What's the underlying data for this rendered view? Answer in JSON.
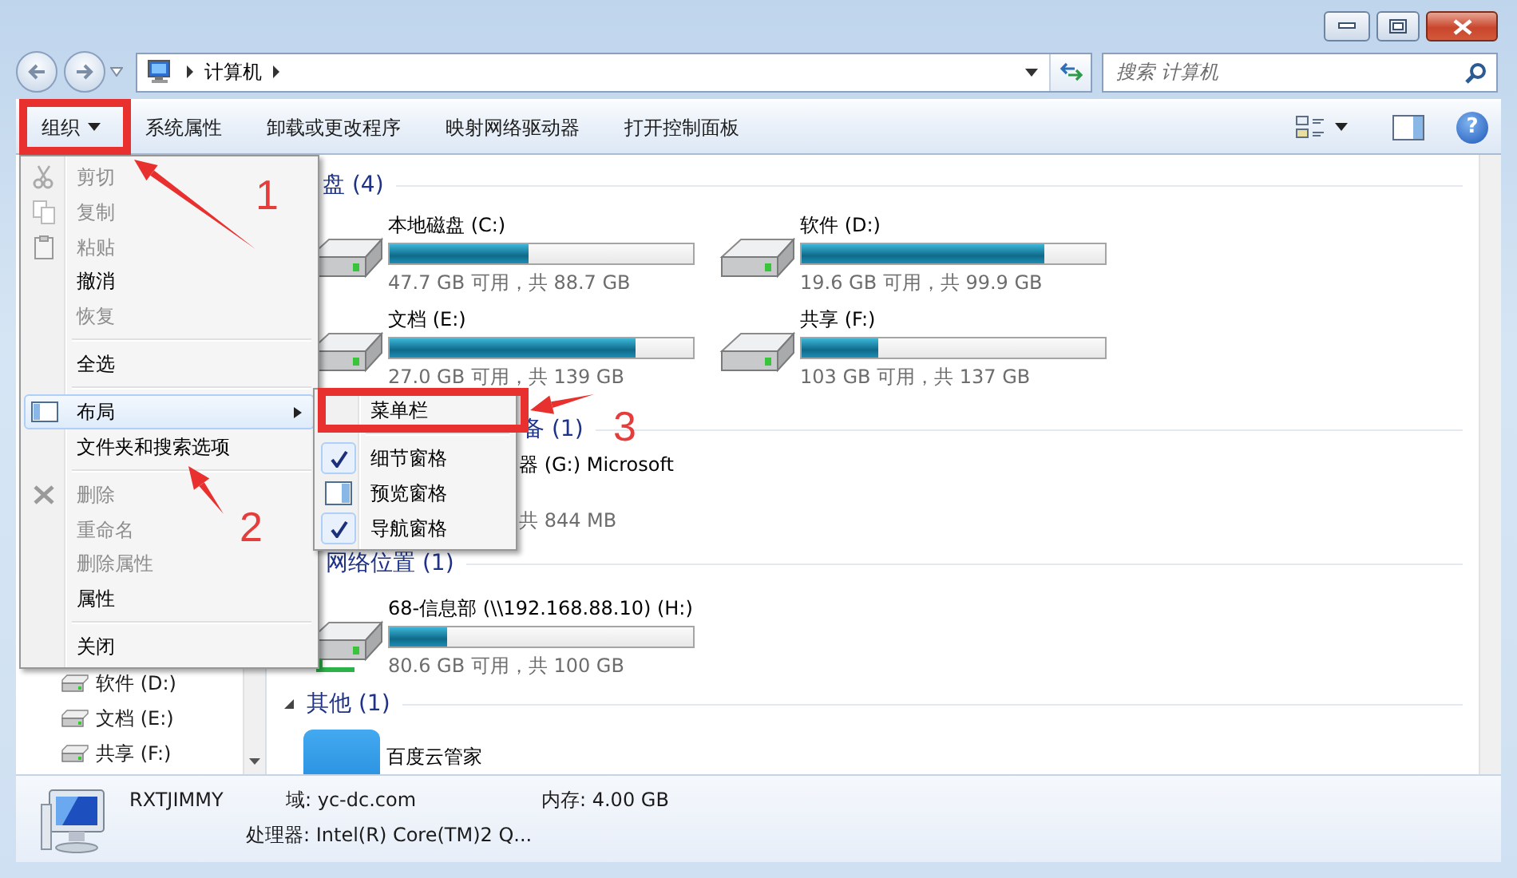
{
  "address_bar": {
    "path": [
      "计算机"
    ],
    "search": {
      "placeholder": "搜索 计算机"
    }
  },
  "toolbar": {
    "buttons": [
      {
        "label": "组织",
        "kind": "menu",
        "annotated": true
      },
      {
        "label": "系统属性",
        "kind": "plain",
        "annotated": false
      },
      {
        "label": "卸载或更改程序",
        "kind": "plain",
        "annotated": false
      },
      {
        "label": "映射网络驱动器",
        "kind": "plain",
        "annotated": false
      },
      {
        "label": "打开控制面板",
        "kind": "plain",
        "annotated": false
      }
    ],
    "help": "?"
  },
  "organize_menu": {
    "items": [
      {
        "kind": "command",
        "label": "剪切",
        "disabled": true,
        "selected": false
      },
      {
        "kind": "command",
        "label": "复制",
        "disabled": true,
        "selected": false
      },
      {
        "kind": "command",
        "label": "粘贴",
        "disabled": true,
        "selected": false
      },
      {
        "kind": "command",
        "label": "撤消",
        "disabled": false,
        "selected": false
      },
      {
        "kind": "command",
        "label": "恢复",
        "disabled": true,
        "selected": false
      },
      {
        "kind": "separator"
      },
      {
        "kind": "command",
        "label": "全选",
        "disabled": false,
        "selected": false
      },
      {
        "kind": "separator"
      },
      {
        "kind": "submenu",
        "label": "布局",
        "disabled": false,
        "selected": true
      },
      {
        "kind": "command",
        "label": "文件夹和搜索选项",
        "disabled": false,
        "selected": false
      },
      {
        "kind": "separator"
      },
      {
        "kind": "command",
        "label": "删除",
        "disabled": true,
        "selected": false
      },
      {
        "kind": "command",
        "label": "重命名",
        "disabled": true,
        "selected": false
      },
      {
        "kind": "command",
        "label": "删除属性",
        "disabled": true,
        "selected": false
      },
      {
        "kind": "command",
        "label": "属性",
        "disabled": false,
        "selected": false
      },
      {
        "kind": "separator"
      },
      {
        "kind": "command",
        "label": "关闭",
        "disabled": false,
        "selected": false
      }
    ]
  },
  "layout_submenu": {
    "items": [
      {
        "kind": "command",
        "label": "菜单栏",
        "checked": false,
        "annotated": true
      },
      {
        "kind": "separator"
      },
      {
        "kind": "command",
        "label": "细节窗格",
        "checked": true,
        "annotated": false
      },
      {
        "kind": "command",
        "label": "预览窗格",
        "checked": false,
        "annotated": false
      },
      {
        "kind": "command",
        "label": "导航窗格",
        "checked": true,
        "annotated": false
      }
    ]
  },
  "navigation_pane": {
    "items": [
      {
        "label": "软件 (D:)"
      },
      {
        "label": "文档 (E:)"
      },
      {
        "label": "共享 (F:)"
      }
    ]
  },
  "content": {
    "sections": [
      {
        "title": "盘 (4)",
        "items": [
          {
            "kind": "disk",
            "name": "本地磁盘 (C:)",
            "level": 0.46,
            "free": "47.7 GB 可用，共 88.7 GB"
          },
          {
            "kind": "disk",
            "name": "软件 (D:)",
            "level": 0.8,
            "free": "19.6 GB 可用，共 99.9 GB"
          },
          {
            "kind": "disk",
            "name": "文档 (E:)",
            "level": 0.81,
            "free": "27.0 GB 可用，共 139 GB"
          },
          {
            "kind": "disk",
            "name": "共享 (F:)",
            "level": 0.25,
            "free": "103 GB 可用，共 137 GB"
          }
        ]
      },
      {
        "title": "备 (1)",
        "items": [
          {
            "kind": "removable",
            "name": "器 (G:) Microsoft",
            "free": "共 844 MB"
          }
        ]
      },
      {
        "title": "网络位置 (1)",
        "items": [
          {
            "kind": "network",
            "name": "68-信息部 (\\\\192.168.88.10) (H:)",
            "level": 0.19,
            "free": "80.6 GB 可用，共 100 GB"
          }
        ]
      },
      {
        "title": "其他 (1)",
        "expanded": true,
        "items": [
          {
            "kind": "app",
            "name": "百度云管家"
          }
        ]
      }
    ]
  },
  "details_pane": {
    "name": "RXTJIMMY",
    "domain": "域: yc-dc.com",
    "memory": "内存: 4.00 GB",
    "processor": "处理器: Intel(R) Core(TM)2 Q..."
  },
  "annotations": [
    {
      "label": "1"
    },
    {
      "label": "2"
    },
    {
      "label": "3"
    }
  ]
}
